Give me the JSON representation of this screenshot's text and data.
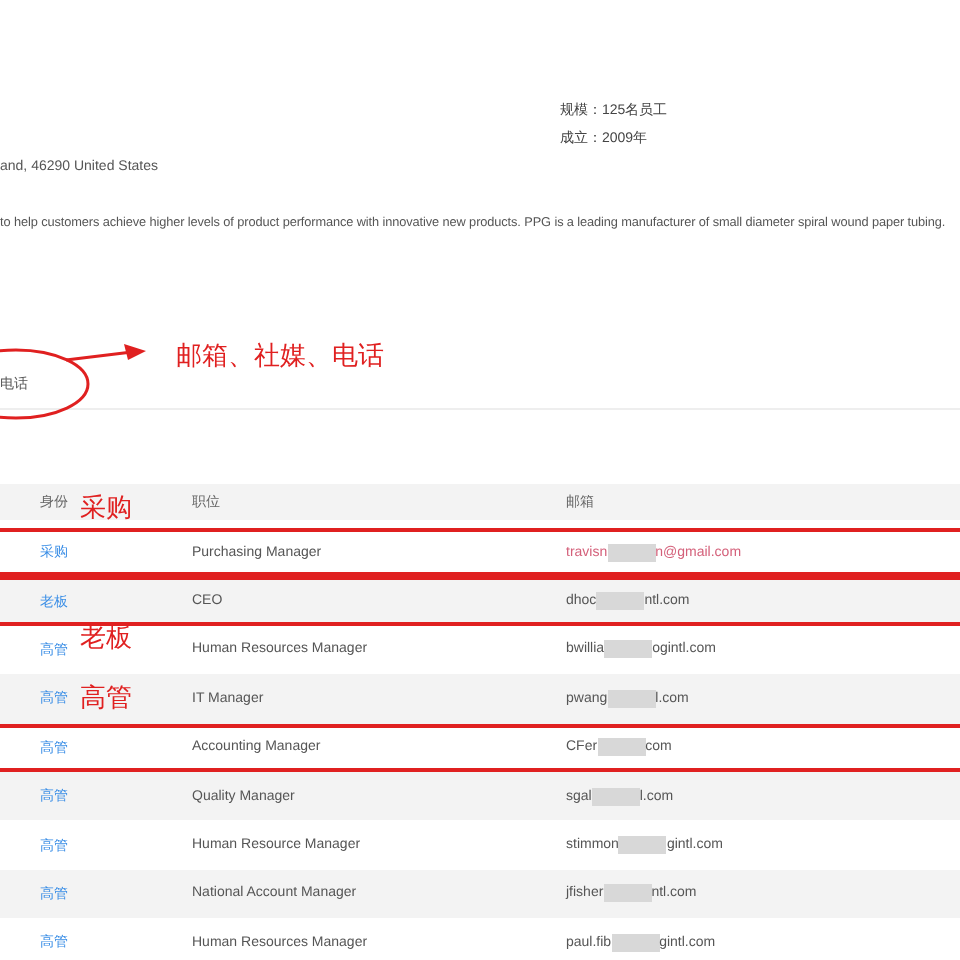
{
  "company": {
    "scale": "规模：125名员工",
    "founded": "成立：2009年",
    "address": "and, 46290 United States",
    "description": "to help customers achieve higher levels of product performance with innovative new products. PPG is a leading manufacturer of small diameter spiral wound paper tubing."
  },
  "tab": {
    "label": "电话"
  },
  "table": {
    "columns": [
      "身份",
      "职位",
      "邮箱"
    ],
    "rows": [
      {
        "role": "采购",
        "title": "Purchasing Manager",
        "email_start": "travisn",
        "email_end": "n@gmail.com",
        "color": "#d4607a",
        "highlighted": true
      },
      {
        "role": "老板",
        "title": "CEO",
        "email_start": "dhoc",
        "email_end": "ntl.com",
        "color": "#555555",
        "highlighted": true
      },
      {
        "role": "高管",
        "title": "Human Resources Manager",
        "email_start": "bwillia",
        "email_end": "ogintl.com",
        "color": "#555555",
        "highlighted": false
      },
      {
        "role": "高管",
        "title": "IT Manager",
        "email_start": "pwang",
        "email_end": "l.com",
        "color": "#555555",
        "highlighted": false
      },
      {
        "role": "高管",
        "title": "Accounting Manager",
        "email_start": "CFer",
        "email_end": "com",
        "color": "#555555",
        "highlighted": true
      },
      {
        "role": "高管",
        "title": "Quality Manager",
        "email_start": "sgal",
        "email_end": "l.com",
        "color": "#555555",
        "highlighted": false
      },
      {
        "role": "高管",
        "title": "Human Resource Manager",
        "email_start": "stimmon",
        "email_end": "gintl.com",
        "color": "#555555",
        "highlighted": false
      },
      {
        "role": "高管",
        "title": "National Account Manager",
        "email_start": "jfisher",
        "email_end": "ntl.com",
        "color": "#555555",
        "highlighted": false
      },
      {
        "role": "高管",
        "title": "Human Resources Manager",
        "email_start": "paul.fib",
        "email_end": "gintl.com",
        "color": "#555555",
        "highlighted": false
      }
    ]
  },
  "annotations": {
    "arrow_note": "邮箱、社媒、电话",
    "labels": [
      "采购",
      "老板",
      "高管"
    ]
  }
}
